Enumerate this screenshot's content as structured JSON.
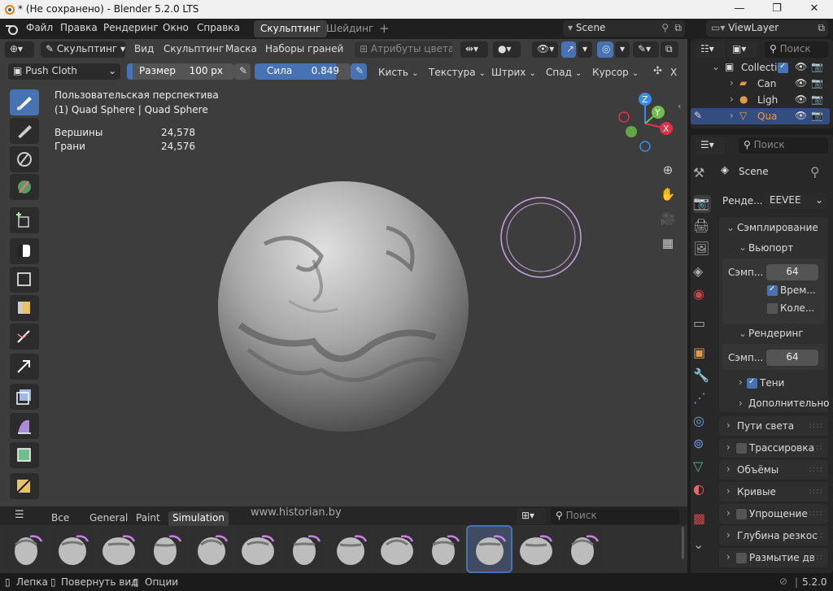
{
  "window": {
    "title": "* (Не сохранено) - Blender 5.2.0 LTS"
  },
  "topbar": {
    "menus": [
      "Файл",
      "Правка",
      "Рендеринг",
      "Окно",
      "Справка"
    ],
    "workspaces": [
      "Скульптинг",
      "Шейдинг"
    ],
    "add_tab": "+",
    "scene_name": "Scene",
    "view_layer": "ViewLayer"
  },
  "viewport_header": {
    "mode": "Скульптинг",
    "menus": [
      "Вид",
      "Скульптинг",
      "Маска",
      "Наборы граней"
    ],
    "color_attributes": "Атрибуты цвета"
  },
  "tool_header": {
    "brush_name": "Push Cloth",
    "size_label": "Размер",
    "size_value": "100 px",
    "strength_label": "Сила",
    "strength_value": "0.849",
    "strength_fraction": 0.849,
    "dropdowns": [
      "Кисть",
      "Текстура",
      "Штрих",
      "Спад",
      "Курсор"
    ],
    "close": "X"
  },
  "overlay_text": {
    "view_name": "Пользовательская перспектива",
    "object_line": "(1) Quad Sphere | Quad Sphere",
    "stats": [
      {
        "label": "Вершины",
        "value": "24,578"
      },
      {
        "label": "Грани",
        "value": "24,576"
      }
    ]
  },
  "gizmo": {
    "x": "X",
    "y": "Y",
    "z": "Z"
  },
  "asset_shelf": {
    "tabs": [
      "Все",
      "General",
      "Paint",
      "Simulation"
    ],
    "active_tab": "Simulation",
    "watermark": "www.historian.by",
    "search_placeholder": "Поиск"
  },
  "outliner": {
    "search_placeholder": "Поиск",
    "rows": [
      "Collecti",
      "Can",
      "Ligh",
      "Qua"
    ]
  },
  "properties": {
    "search_placeholder": "Поиск",
    "scene": "Scene",
    "render_engine_label": "Ренде...",
    "render_engine": "EEVEE",
    "sampling": "Сэмплирование",
    "viewport": "Вьюпорт",
    "viewport_samples_label": "Сэмп...",
    "viewport_samples": "64",
    "temporal": "Врем...",
    "color": "Коле...",
    "render": "Рендеринг",
    "render_samples_label": "Сэмп...",
    "render_samples": "64",
    "shadows": "Тени",
    "advanced": "Дополнительно",
    "sections": [
      "Пути света",
      "Трассировка",
      "Объёмы",
      "Кривые",
      "Упрощение",
      "Глубина резкос",
      "Размытие дв"
    ]
  },
  "statusbar": {
    "items": [
      "Лепка",
      "Повернуть вид",
      "Опции"
    ],
    "version": "5.2.0"
  },
  "colors": {
    "accent": "#4772b3",
    "slider": "#2a5db0",
    "viewport": "#3d3d3d",
    "ring": "#c9a2e6"
  }
}
